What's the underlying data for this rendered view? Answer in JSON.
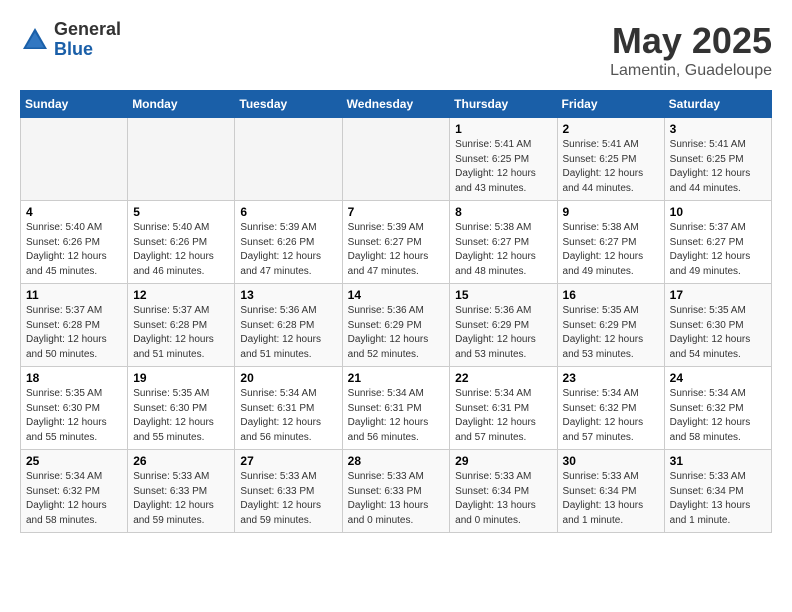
{
  "logo": {
    "general": "General",
    "blue": "Blue"
  },
  "title": "May 2025",
  "subtitle": "Lamentin, Guadeloupe",
  "weekdays": [
    "Sunday",
    "Monday",
    "Tuesday",
    "Wednesday",
    "Thursday",
    "Friday",
    "Saturday"
  ],
  "weeks": [
    [
      {
        "day": "",
        "info": ""
      },
      {
        "day": "",
        "info": ""
      },
      {
        "day": "",
        "info": ""
      },
      {
        "day": "",
        "info": ""
      },
      {
        "day": "1",
        "info": "Sunrise: 5:41 AM\nSunset: 6:25 PM\nDaylight: 12 hours\nand 43 minutes."
      },
      {
        "day": "2",
        "info": "Sunrise: 5:41 AM\nSunset: 6:25 PM\nDaylight: 12 hours\nand 44 minutes."
      },
      {
        "day": "3",
        "info": "Sunrise: 5:41 AM\nSunset: 6:25 PM\nDaylight: 12 hours\nand 44 minutes."
      }
    ],
    [
      {
        "day": "4",
        "info": "Sunrise: 5:40 AM\nSunset: 6:26 PM\nDaylight: 12 hours\nand 45 minutes."
      },
      {
        "day": "5",
        "info": "Sunrise: 5:40 AM\nSunset: 6:26 PM\nDaylight: 12 hours\nand 46 minutes."
      },
      {
        "day": "6",
        "info": "Sunrise: 5:39 AM\nSunset: 6:26 PM\nDaylight: 12 hours\nand 47 minutes."
      },
      {
        "day": "7",
        "info": "Sunrise: 5:39 AM\nSunset: 6:27 PM\nDaylight: 12 hours\nand 47 minutes."
      },
      {
        "day": "8",
        "info": "Sunrise: 5:38 AM\nSunset: 6:27 PM\nDaylight: 12 hours\nand 48 minutes."
      },
      {
        "day": "9",
        "info": "Sunrise: 5:38 AM\nSunset: 6:27 PM\nDaylight: 12 hours\nand 49 minutes."
      },
      {
        "day": "10",
        "info": "Sunrise: 5:37 AM\nSunset: 6:27 PM\nDaylight: 12 hours\nand 49 minutes."
      }
    ],
    [
      {
        "day": "11",
        "info": "Sunrise: 5:37 AM\nSunset: 6:28 PM\nDaylight: 12 hours\nand 50 minutes."
      },
      {
        "day": "12",
        "info": "Sunrise: 5:37 AM\nSunset: 6:28 PM\nDaylight: 12 hours\nand 51 minutes."
      },
      {
        "day": "13",
        "info": "Sunrise: 5:36 AM\nSunset: 6:28 PM\nDaylight: 12 hours\nand 51 minutes."
      },
      {
        "day": "14",
        "info": "Sunrise: 5:36 AM\nSunset: 6:29 PM\nDaylight: 12 hours\nand 52 minutes."
      },
      {
        "day": "15",
        "info": "Sunrise: 5:36 AM\nSunset: 6:29 PM\nDaylight: 12 hours\nand 53 minutes."
      },
      {
        "day": "16",
        "info": "Sunrise: 5:35 AM\nSunset: 6:29 PM\nDaylight: 12 hours\nand 53 minutes."
      },
      {
        "day": "17",
        "info": "Sunrise: 5:35 AM\nSunset: 6:30 PM\nDaylight: 12 hours\nand 54 minutes."
      }
    ],
    [
      {
        "day": "18",
        "info": "Sunrise: 5:35 AM\nSunset: 6:30 PM\nDaylight: 12 hours\nand 55 minutes."
      },
      {
        "day": "19",
        "info": "Sunrise: 5:35 AM\nSunset: 6:30 PM\nDaylight: 12 hours\nand 55 minutes."
      },
      {
        "day": "20",
        "info": "Sunrise: 5:34 AM\nSunset: 6:31 PM\nDaylight: 12 hours\nand 56 minutes."
      },
      {
        "day": "21",
        "info": "Sunrise: 5:34 AM\nSunset: 6:31 PM\nDaylight: 12 hours\nand 56 minutes."
      },
      {
        "day": "22",
        "info": "Sunrise: 5:34 AM\nSunset: 6:31 PM\nDaylight: 12 hours\nand 57 minutes."
      },
      {
        "day": "23",
        "info": "Sunrise: 5:34 AM\nSunset: 6:32 PM\nDaylight: 12 hours\nand 57 minutes."
      },
      {
        "day": "24",
        "info": "Sunrise: 5:34 AM\nSunset: 6:32 PM\nDaylight: 12 hours\nand 58 minutes."
      }
    ],
    [
      {
        "day": "25",
        "info": "Sunrise: 5:34 AM\nSunset: 6:32 PM\nDaylight: 12 hours\nand 58 minutes."
      },
      {
        "day": "26",
        "info": "Sunrise: 5:33 AM\nSunset: 6:33 PM\nDaylight: 12 hours\nand 59 minutes."
      },
      {
        "day": "27",
        "info": "Sunrise: 5:33 AM\nSunset: 6:33 PM\nDaylight: 12 hours\nand 59 minutes."
      },
      {
        "day": "28",
        "info": "Sunrise: 5:33 AM\nSunset: 6:33 PM\nDaylight: 13 hours\nand 0 minutes."
      },
      {
        "day": "29",
        "info": "Sunrise: 5:33 AM\nSunset: 6:34 PM\nDaylight: 13 hours\nand 0 minutes."
      },
      {
        "day": "30",
        "info": "Sunrise: 5:33 AM\nSunset: 6:34 PM\nDaylight: 13 hours\nand 1 minute."
      },
      {
        "day": "31",
        "info": "Sunrise: 5:33 AM\nSunset: 6:34 PM\nDaylight: 13 hours\nand 1 minute."
      }
    ]
  ]
}
